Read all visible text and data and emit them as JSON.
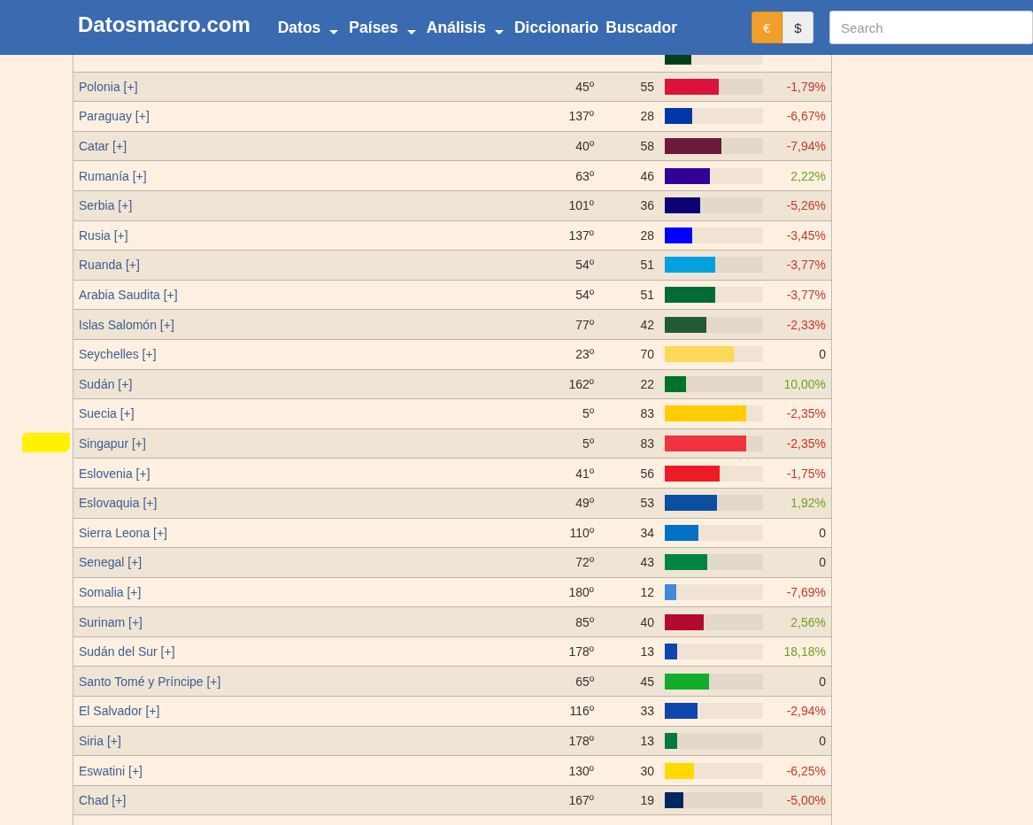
{
  "header": {
    "logo": "Datosmacro.com",
    "nav": [
      {
        "label": "Datos",
        "dropdown": true
      },
      {
        "label": "Países",
        "dropdown": true
      },
      {
        "label": "Análisis",
        "dropdown": true
      },
      {
        "label": "Diccionario",
        "dropdown": false
      },
      {
        "label": "Buscador",
        "dropdown": false
      }
    ],
    "currency": [
      {
        "label": "€",
        "selected": true
      },
      {
        "label": "$",
        "selected": false
      }
    ],
    "search": {
      "placeholder": "Search"
    }
  },
  "table": {
    "rows": [
      {
        "level": 0.27,
        "color": "#00401a",
        "highlighted": false
      },
      {
        "country": "Polonia [+]",
        "rank": "45º",
        "score": "55",
        "level": 0.55,
        "color": "#dc143c",
        "change": {
          "text": "-1,79%",
          "color": "#c0392b"
        },
        "highlighted": false
      },
      {
        "country": "Paraguay [+]",
        "rank": "137º",
        "score": "28",
        "level": 0.28,
        "color": "#0038a8",
        "change": {
          "text": "-6,67%",
          "color": "#c0392b"
        },
        "highlighted": false
      },
      {
        "country": "Catar [+]",
        "rank": "40º",
        "score": "58",
        "level": 0.58,
        "color": "#6c1a3a",
        "change": {
          "text": "-7,94%",
          "color": "#c0392b"
        },
        "highlighted": false
      },
      {
        "country": "Rumanía [+]",
        "rank": "63º",
        "score": "46",
        "level": 0.46,
        "color": "#330099",
        "change": {
          "text": "2,22%",
          "color": "#6aa51e"
        },
        "highlighted": false
      },
      {
        "country": "Serbia [+]",
        "rank": "101º",
        "score": "36",
        "level": 0.36,
        "color": "#0c0075",
        "change": {
          "text": "-5,26%",
          "color": "#c0392b"
        },
        "highlighted": false
      },
      {
        "country": "Rusia [+]",
        "rank": "137º",
        "score": "28",
        "level": 0.28,
        "color": "#0000ff",
        "change": {
          "text": "-3,45%",
          "color": "#c0392b"
        },
        "highlighted": false
      },
      {
        "country": "Ruanda [+]",
        "rank": "54º",
        "score": "51",
        "level": 0.51,
        "color": "#00a1de",
        "change": {
          "text": "-3,77%",
          "color": "#c0392b"
        },
        "highlighted": false
      },
      {
        "country": "Arabia Saudita [+]",
        "rank": "54º",
        "score": "51",
        "level": 0.51,
        "color": "#006c35",
        "change": {
          "text": "-3,77%",
          "color": "#c0392b"
        },
        "highlighted": false
      },
      {
        "country": "Islas Salomón [+]",
        "rank": "77º",
        "score": "42",
        "level": 0.42,
        "color": "#215b33",
        "change": {
          "text": "-2,33%",
          "color": "#c0392b"
        },
        "highlighted": false
      },
      {
        "country": "Seychelles [+]",
        "rank": "23º",
        "score": "70",
        "level": 0.7,
        "color": "#fcd856",
        "change": {
          "text": "0",
          "color": "#333333"
        },
        "highlighted": false
      },
      {
        "country": "Sudán [+]",
        "rank": "162º",
        "score": "22",
        "level": 0.22,
        "color": "#007229",
        "change": {
          "text": "10,00%",
          "color": "#6aa51e"
        },
        "highlighted": false
      },
      {
        "country": "Suecia [+]",
        "rank": "5º",
        "score": "83",
        "level": 0.83,
        "color": "#fecc00",
        "change": {
          "text": "-2,35%",
          "color": "#c0392b"
        },
        "highlighted": false
      },
      {
        "country": "Singapur [+]",
        "rank": "5º",
        "score": "83",
        "level": 0.83,
        "color": "#ef3340",
        "change": {
          "text": "-2,35%",
          "color": "#c0392b"
        },
        "highlighted": true
      },
      {
        "country": "Eslovenia [+]",
        "rank": "41º",
        "score": "56",
        "level": 0.56,
        "color": "#ed1c24",
        "change": {
          "text": "-1,75%",
          "color": "#c0392b"
        },
        "highlighted": false
      },
      {
        "country": "Eslovaquia [+]",
        "rank": "49º",
        "score": "53",
        "level": 0.53,
        "color": "#0b4ea2",
        "change": {
          "text": "1,92%",
          "color": "#6aa51e"
        },
        "highlighted": false
      },
      {
        "country": "Sierra Leona [+]",
        "rank": "110º",
        "score": "34",
        "level": 0.34,
        "color": "#0072c6",
        "change": {
          "text": "0",
          "color": "#333333"
        },
        "highlighted": false
      },
      {
        "country": "Senegal [+]",
        "rank": "72º",
        "score": "43",
        "level": 0.43,
        "color": "#00853f",
        "change": {
          "text": "0",
          "color": "#333333"
        },
        "highlighted": false
      },
      {
        "country": "Somalia [+]",
        "rank": "180º",
        "score": "12",
        "level": 0.12,
        "color": "#4189dd",
        "change": {
          "text": "-7,69%",
          "color": "#c0392b"
        },
        "highlighted": false
      },
      {
        "country": "Surinam [+]",
        "rank": "85º",
        "score": "40",
        "level": 0.4,
        "color": "#b40a2d",
        "change": {
          "text": "2,56%",
          "color": "#6aa51e"
        },
        "highlighted": false
      },
      {
        "country": "Sudán del Sur [+]",
        "rank": "178º",
        "score": "13",
        "level": 0.13,
        "color": "#0f47af",
        "change": {
          "text": "18,18%",
          "color": "#6aa51e"
        },
        "highlighted": false
      },
      {
        "country": "Santo Tomé y Príncipe [+]",
        "rank": "65º",
        "score": "45",
        "level": 0.45,
        "color": "#12ad2b",
        "change": {
          "text": "0",
          "color": "#333333"
        },
        "highlighted": false
      },
      {
        "country": "El Salvador [+]",
        "rank": "116º",
        "score": "33",
        "level": 0.33,
        "color": "#0f47ae",
        "change": {
          "text": "-2,94%",
          "color": "#c0392b"
        },
        "highlighted": false
      },
      {
        "country": "Siria [+]",
        "rank": "178º",
        "score": "13",
        "level": 0.13,
        "color": "#007a3d",
        "change": {
          "text": "0",
          "color": "#333333"
        },
        "highlighted": false
      },
      {
        "country": "Eswatini [+]",
        "rank": "130º",
        "score": "30",
        "level": 0.3,
        "color": "#ffd900",
        "change": {
          "text": "-6,25%",
          "color": "#c0392b"
        },
        "highlighted": false
      },
      {
        "country": "Chad [+]",
        "rank": "167º",
        "score": "19",
        "level": 0.19,
        "color": "#002664",
        "change": {
          "text": "-5,00%",
          "color": "#c0392b"
        },
        "highlighted": false
      }
    ]
  }
}
